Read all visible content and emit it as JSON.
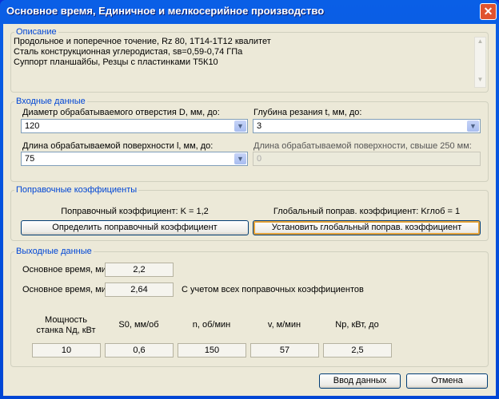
{
  "window": {
    "title": "Основное время, Единичное и мелкосерийное производство"
  },
  "description": {
    "legend": "Описание",
    "lines": [
      "Продольное и поперечное точение, Rz 80, 1Т14-1Т12 квалитет",
      "Сталь конструкционная углеродистая, sв=0,59-0,74 ГПа",
      "Суппорт планшайбы, Резцы с пластинками Т5К10"
    ]
  },
  "input": {
    "legend": "Входные данные",
    "diameter_label": "Диаметр обрабатываемого отверстия D, мм, до:",
    "diameter_value": "120",
    "depth_label": "Глубина резания t, мм, до:",
    "depth_value": "3",
    "length_label": "Длина обрабатываемой поверхности l, мм, до:",
    "length_value": "75",
    "length_over_label": "Длина обрабатываемой поверхности, свыше 250 мм:",
    "length_over_value": "0"
  },
  "coefficients": {
    "legend": "Поправочные коэффициенты",
    "k_text": "Поправочный коэффициент: K = 1,2",
    "kglob_text": "Глобальный поправ. коэффициент: Kглоб = 1",
    "determine_button": "Определить поправочный коэффициент",
    "set_global_button": "Установить  глобальный поправ. коэффициент"
  },
  "output": {
    "legend": "Выходные данные",
    "time_label": "Основное время, мин:",
    "time_value": "2,2",
    "time2_label": "Основное время, мин:",
    "time2_value": "2,64",
    "time2_note": "С учетом всех поправочных коэффициентов",
    "columns": [
      {
        "header": "Мощность станка Nд, кВт",
        "value": "10"
      },
      {
        "header": "S0, мм/об",
        "value": "0,6"
      },
      {
        "header": "n, об/мин",
        "value": "150"
      },
      {
        "header": "v, м/мин",
        "value": "57"
      },
      {
        "header": "Nр, кВт, до",
        "value": "2,5"
      }
    ]
  },
  "footer": {
    "ok_button": "Ввод данных",
    "cancel_button": "Отмена"
  }
}
